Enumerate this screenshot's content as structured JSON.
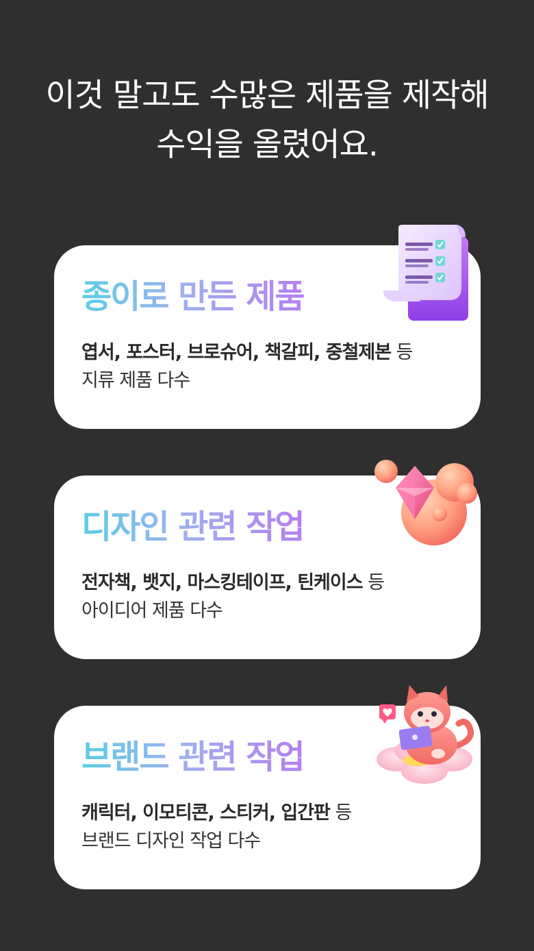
{
  "headline": {
    "line1": "이것 말고도 수많은 제품을 제작해",
    "line2": "수익을 올렸어요."
  },
  "cards": [
    {
      "title": "종이로 만든 제품",
      "desc_bold": "엽서, 포스터, 브로슈어, 책갈피, 중철제본",
      "desc_suffix": " 등",
      "desc_line2": "지류 제품 다수",
      "icon": "checklist-document-icon"
    },
    {
      "title": "디자인 관련 작업",
      "desc_bold": "전자책, 뱃지, 마스킹테이프, 틴케이스",
      "desc_suffix": " 등",
      "desc_line2": "아이디어 제품 다수",
      "icon": "gem-bubbles-icon"
    },
    {
      "title": "브랜드 관련 작업",
      "desc_bold": "캐릭터, 이모티콘, 스티커, 입간판",
      "desc_suffix": " 등",
      "desc_line2": "브랜드 디자인 작업 다수",
      "icon": "cat-laptop-icon"
    }
  ],
  "colors": {
    "background": "#2f2f2f",
    "card": "#ffffff",
    "title_gradient_start": "#5ccde6",
    "title_gradient_end": "#b47ff2"
  }
}
